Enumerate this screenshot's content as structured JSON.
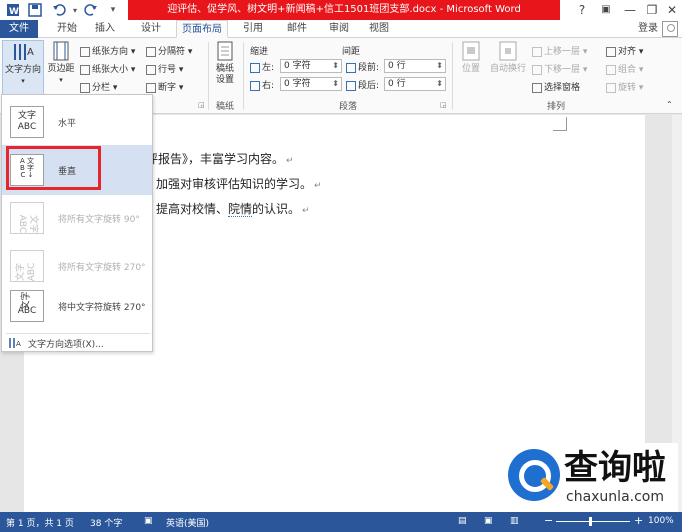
{
  "title_bar": {
    "title": "迎评估、促学风、树文明+新闻稿+信工1501班团支部.docx - Microsoft Word",
    "help": "?",
    "ribbon_options": "▣",
    "minimize": "—",
    "restore": "❐",
    "close": "✕"
  },
  "tabs": [
    "文件",
    "开始",
    "插入",
    "设计",
    "页面布局",
    "引用",
    "邮件",
    "审阅",
    "视图"
  ],
  "active_tab": "页面布局",
  "login": "登录",
  "ribbon": {
    "page_setup": {
      "text_direction": "文字方向",
      "margins": "页边距",
      "orientation": "纸张方向",
      "size": "纸张大小",
      "columns": "分栏",
      "breaks": "分隔符",
      "line_numbers": "行号",
      "hyphenation": "断字"
    },
    "draft": {
      "draft_settings_line1": "稿纸",
      "draft_settings_line2": "设置",
      "group_label": "稿纸"
    },
    "paragraph": {
      "indent_header": "缩进",
      "spacing_header": "间距",
      "left_label": "左:",
      "left_value": "0 字符",
      "right_label": "右:",
      "right_value": "0 字符",
      "before_label": "段前:",
      "before_value": "0 行",
      "after_label": "段后:",
      "after_value": "0 行",
      "group_label": "段落"
    },
    "arrange": {
      "position": "位置",
      "wrap_text": "自动换行",
      "bring_forward": "上移一层",
      "send_backward": "下移一层",
      "selection_pane": "选择窗格",
      "align": "对齐",
      "group": "组合",
      "rotate": "旋转",
      "group_label": "排列"
    }
  },
  "text_direction_menu": {
    "items": [
      {
        "icon_text": "文字\nABC",
        "label": "水平"
      },
      {
        "icon_text": "ABC",
        "label": "垂直"
      },
      {
        "icon_text": "文字 ABC",
        "label": "将所有文字旋转 90°"
      },
      {
        "icon_text": "文字 ABC",
        "label": "将所有文字旋转 270°"
      },
      {
        "icon_text": "文字\nABC",
        "label": "将中文字符旋转 270°"
      }
    ],
    "options": "文字方向选项(X)..."
  },
  "document": {
    "lines": [
      "评报告》，丰富学习内容。",
      "加强对审核评估知识的学习。",
      "提高对校情、院情的认识。"
    ],
    "underlined_word": "院情"
  },
  "status_bar": {
    "page": "第 1 页，共 1 页",
    "words": "38 个字",
    "language": "英语(美国)",
    "zoom": "100%",
    "zoom_minus": "−",
    "zoom_plus": "+"
  },
  "watermark": {
    "name": "查询啦",
    "url": "chaxunla.com"
  },
  "colors": {
    "word_blue": "#2b579a",
    "title_red": "#e8161b",
    "highlight_box": "#e8252a",
    "hover_bg": "#d5e1f2"
  }
}
